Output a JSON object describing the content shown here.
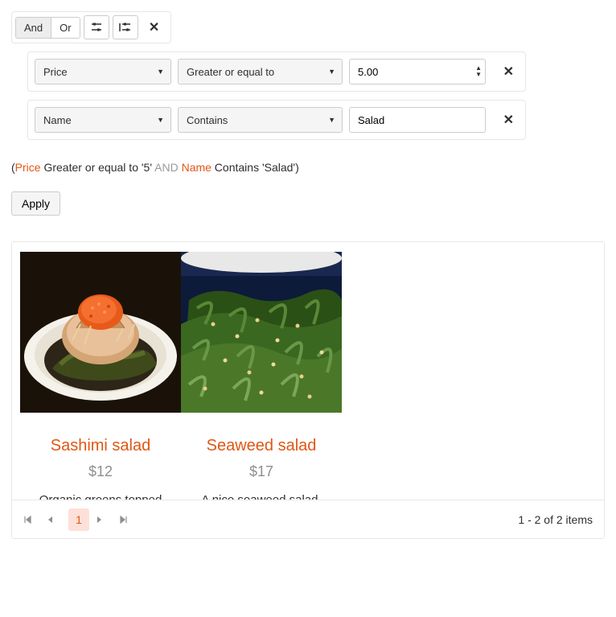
{
  "filter": {
    "logic": {
      "and": "And",
      "or": "Or",
      "selected": "and"
    },
    "rows": [
      {
        "field": "Price",
        "operator": "Greater or equal to",
        "value": "5.00",
        "type": "number"
      },
      {
        "field": "Name",
        "operator": "Contains",
        "value": "Salad",
        "type": "text"
      }
    ]
  },
  "expression": {
    "open": "(",
    "field1": "Price",
    "op1": " Greater or equal to '5' ",
    "logic": "AND",
    "field2": " Name",
    "op2": " Contains 'Salad')"
  },
  "apply_label": "Apply",
  "items": [
    {
      "name": "Sashimi salad",
      "price": "$12",
      "desc": "Organic greens topped"
    },
    {
      "name": "Seaweed salad",
      "price": "$17",
      "desc": "A nice seaweed salad."
    }
  ],
  "pager": {
    "page": "1",
    "info": "1 - 2 of 2 items"
  }
}
